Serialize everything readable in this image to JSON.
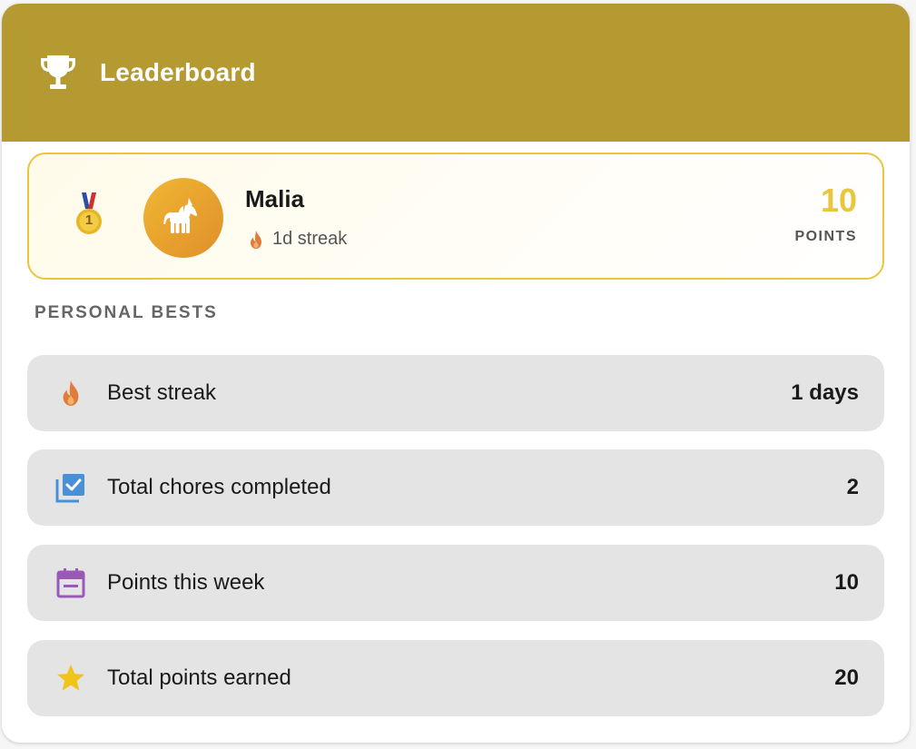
{
  "colors": {
    "header_bg": "#b59a32",
    "accent_gold": "#e8c63e",
    "flame": "#e07b3a",
    "chores_blue": "#4a90d9",
    "calendar_purple": "#9b59b6",
    "star_yellow": "#f0c419",
    "row_bg": "#e4e4e4"
  },
  "header": {
    "icon": "trophy-icon",
    "title": "Leaderboard"
  },
  "leader": {
    "rank_icon": "first-place-medal-icon",
    "rank": "1",
    "avatar_icon": "unicorn-icon",
    "name": "Malia",
    "streak_icon": "flame-icon",
    "streak": "1d streak",
    "points": "10",
    "points_label": "POINTS"
  },
  "personal_bests": {
    "title": "PERSONAL BESTS",
    "items": [
      {
        "icon": "flame-icon",
        "label": "Best streak",
        "value": "1 days"
      },
      {
        "icon": "chores-check-icon",
        "label": "Total chores completed",
        "value": "2"
      },
      {
        "icon": "calendar-icon",
        "label": "Points this week",
        "value": "10"
      },
      {
        "icon": "star-icon",
        "label": "Total points earned",
        "value": "20"
      }
    ]
  }
}
